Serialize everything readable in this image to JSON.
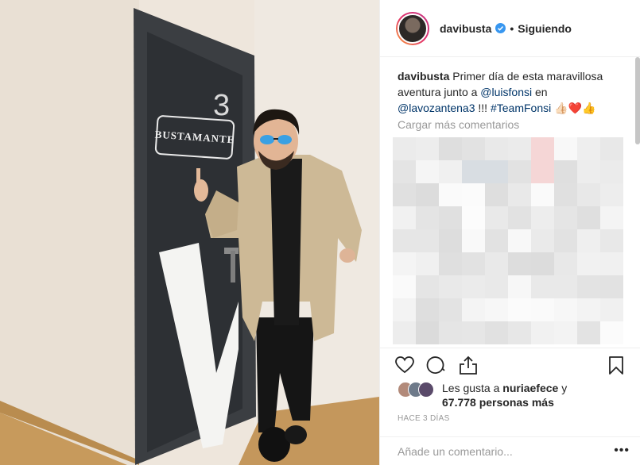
{
  "header": {
    "username": "davibusta",
    "separator": "•",
    "follow_status": "Siguiendo"
  },
  "photo": {
    "door_sign": "BUSTAMANTE",
    "door_number": "3"
  },
  "caption": {
    "username": "davibusta",
    "text_1": "Primer día de esta maravillosa aventura junto a",
    "mention_1": "@luisfonsi",
    "text_2": "en",
    "mention_2": "@lavozantena3",
    "text_3": "!!!",
    "hashtag": "#TeamFonsi",
    "emojis": "👍🏻❤️👍"
  },
  "load_more": "Cargar más comentarios",
  "likes": {
    "prefix": "Les gusta a",
    "user": "nuriaefece",
    "conj": "y",
    "count": "67.778 personas más"
  },
  "timestamp": "HACE 3 DÍAS",
  "comment_input": {
    "placeholder": "Añade un comentario...",
    "more": "•••"
  },
  "icons": [
    "heart-icon",
    "comment-icon",
    "share-icon",
    "bookmark-icon",
    "verified-icon"
  ],
  "colors": {
    "link": "#003569",
    "muted": "#999999",
    "verified": "#3897f0"
  }
}
